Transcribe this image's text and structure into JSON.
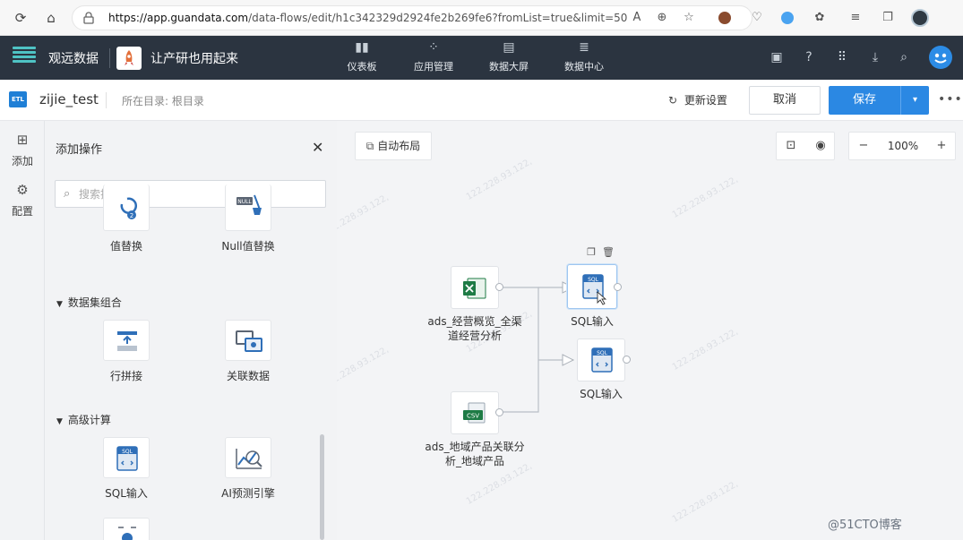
{
  "browser": {
    "url_host": "https://app.guandata.com",
    "url_path": "/data-flows/edit/h1c342329d2924fe2b269fe6?fromList=true&limit=50"
  },
  "header": {
    "brand": "观远数据",
    "slogan": "让产研也用起来",
    "nav": [
      {
        "label": "仪表板",
        "icon": "bar-chart-icon"
      },
      {
        "label": "应用管理",
        "icon": "apps-icon"
      },
      {
        "label": "数据大屏",
        "icon": "screen-icon"
      },
      {
        "label": "数据中心",
        "icon": "database-icon"
      }
    ]
  },
  "toolbar": {
    "badge": "ETL",
    "flow_name": "zijie_test",
    "directory": "所在目录: 根目录",
    "refresh_label": "更新设置",
    "cancel_label": "取消",
    "save_label": "保存"
  },
  "rail": {
    "add_label": "添加",
    "config_label": "配置"
  },
  "panel": {
    "title": "添加操作",
    "search_placeholder": "搜索操作",
    "top_ops": [
      "值替换",
      "Null值替换"
    ],
    "groups": [
      {
        "title": "数据集组合",
        "ops": [
          "行拼接",
          "关联数据"
        ]
      },
      {
        "title": "高级计算",
        "ops": [
          "SQL输入",
          "AI预测引擎"
        ]
      }
    ]
  },
  "canvas": {
    "auto_layout": "自动布局",
    "zoom": "100%",
    "nodes": [
      {
        "label": "ads_经营概览_全渠道经营分析",
        "line1": "ads_经营概览_全渠",
        "line2": "道经营分析",
        "icon": "excel-icon"
      },
      {
        "label": "ads_地域产品关联分析_地域产品",
        "line1": "ads_地域产品关联分",
        "line2": "析_地域产品",
        "icon": "csv-icon"
      },
      {
        "label": "SQL输入",
        "icon": "sql-icon"
      },
      {
        "label": "SQL输入",
        "icon": "sql-icon"
      }
    ],
    "watermark": "122.228.93.122,"
  },
  "colors": {
    "header_bg": "#2b3440",
    "primary": "#2b88e3",
    "excel_green": "#1e7b45",
    "csv_green": "#1e7b45"
  },
  "corner_watermark": "@51CTO博客"
}
